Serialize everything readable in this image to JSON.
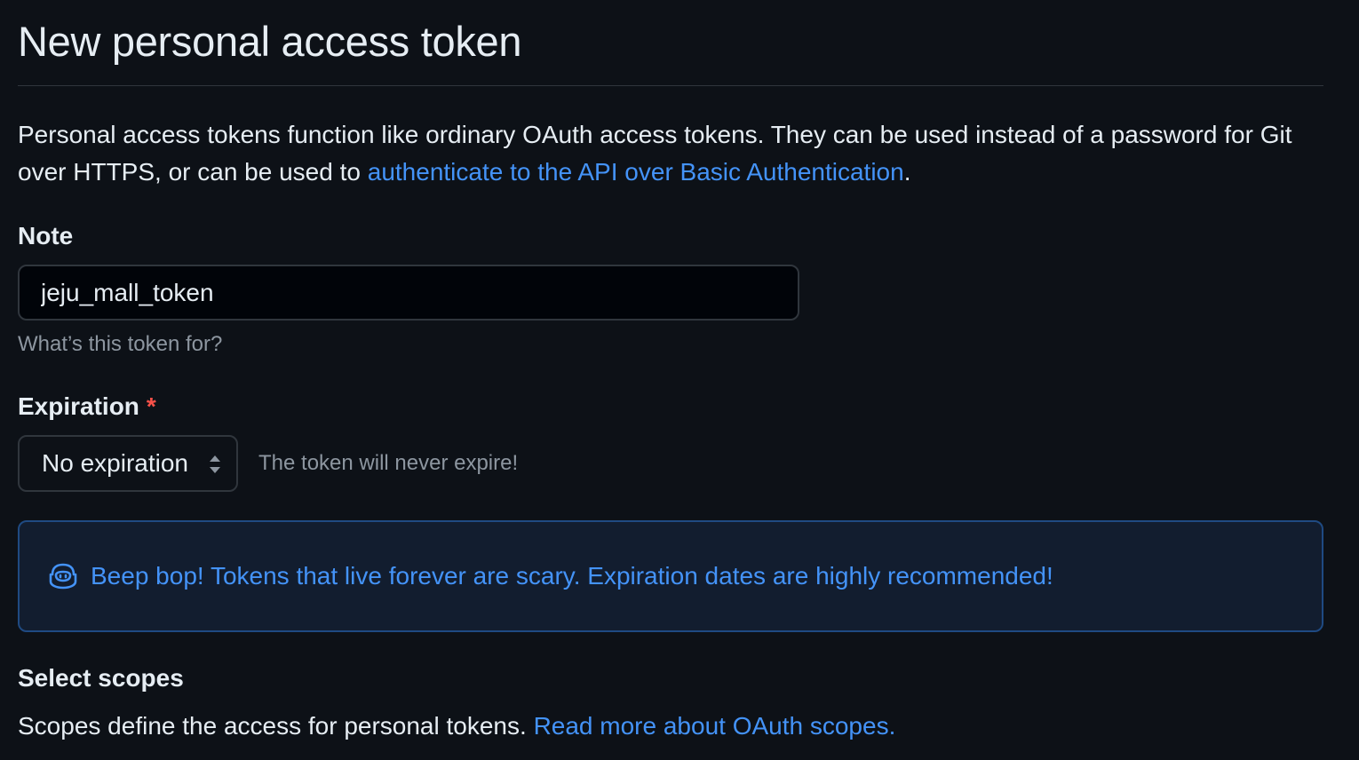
{
  "page": {
    "title": "New personal access token"
  },
  "intro": {
    "text_before_link": "Personal access tokens function like ordinary OAuth access tokens. They can be used instead of a password for Git over HTTPS, or can be used to ",
    "link_text": "authenticate to the API over Basic Authentication",
    "text_after_link": "."
  },
  "note": {
    "label": "Note",
    "value": "jeju_mall_token",
    "hint": "What’s this token for?"
  },
  "expiration": {
    "label": "Expiration",
    "required_marker": "*",
    "selected": "No expiration",
    "note": "The token will never expire!"
  },
  "flash": {
    "icon": "copilot-icon",
    "message": "Beep bop! Tokens that live forever are scary. Expiration dates are highly recommended!"
  },
  "scopes": {
    "heading": "Select scopes",
    "description": "Scopes define the access for personal tokens. ",
    "link_text": "Read more about OAuth scopes."
  },
  "colors": {
    "background": "#0d1117",
    "text": "#e6edf3",
    "muted": "#8d96a0",
    "accent": "#4493f8",
    "danger": "#f85149",
    "border": "#30363d"
  }
}
